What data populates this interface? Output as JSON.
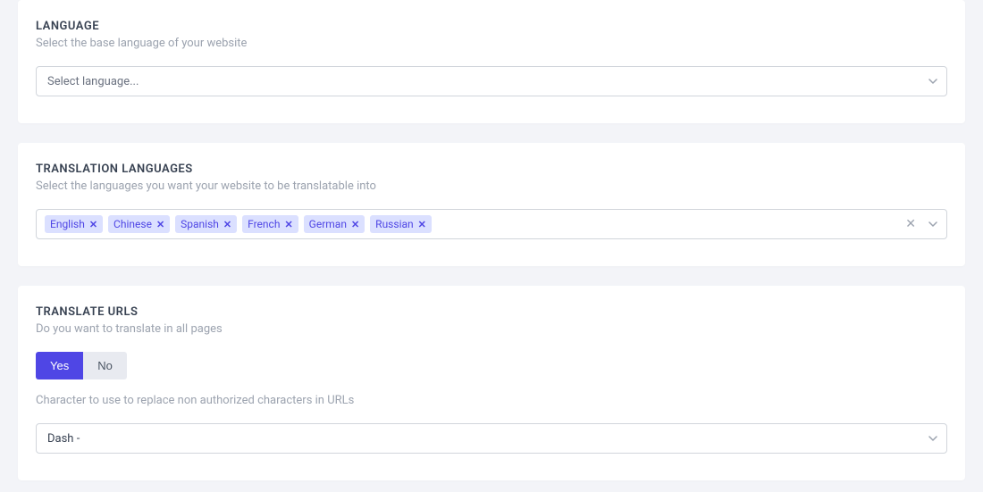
{
  "language": {
    "title": "LANGUAGE",
    "desc": "Select the base language of your website",
    "placeholder": "Select language..."
  },
  "translation_languages": {
    "title": "TRANSLATION LANGUAGES",
    "desc": "Select the languages you want your website to be translatable into",
    "tags": [
      "English",
      "Chinese",
      "Spanish",
      "French",
      "German",
      "Russian"
    ]
  },
  "translate_urls": {
    "title": "TRANSLATE URLS",
    "desc": "Do you want to translate in all pages",
    "yes": "Yes",
    "no": "No",
    "char_desc": "Character to use to replace non authorized characters in URLs",
    "char_value": "Dash -"
  }
}
